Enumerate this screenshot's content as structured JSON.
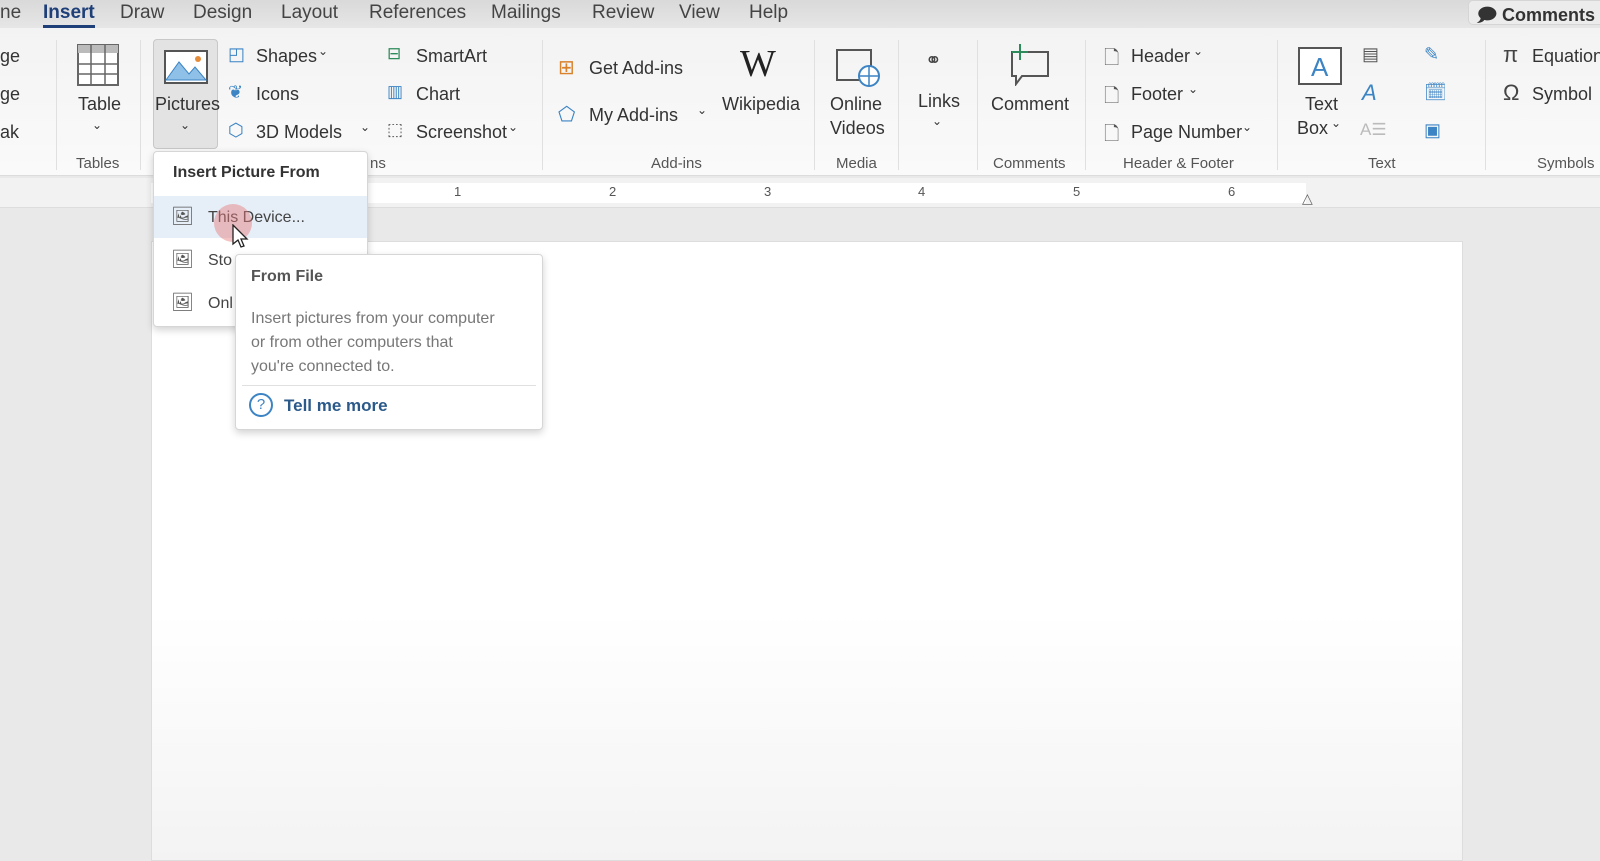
{
  "tabs": [
    {
      "label": "ne"
    },
    {
      "label": "Insert",
      "active": true
    },
    {
      "label": "Draw"
    },
    {
      "label": "Design"
    },
    {
      "label": "Layout"
    },
    {
      "label": "References"
    },
    {
      "label": "Mailings"
    },
    {
      "label": "Review"
    },
    {
      "label": "View"
    },
    {
      "label": "Help"
    }
  ],
  "comments_button": "Comments",
  "ribbon": {
    "partial_left": [
      "ge",
      "ge",
      "ak"
    ],
    "tables": {
      "table": "Table",
      "label": "Tables"
    },
    "illustrations": {
      "pictures": "Pictures",
      "shapes": "Shapes",
      "icons": "Icons",
      "models": "3D Models",
      "smartart": "SmartArt",
      "chart": "Chart",
      "screenshot": "Screenshot",
      "label_partial": "ns"
    },
    "addins": {
      "get": "Get Add-ins",
      "my": "My Add-ins",
      "wikipedia": "Wikipedia",
      "label": "Add-ins"
    },
    "media": {
      "online_videos_1": "Online",
      "online_videos_2": "Videos",
      "label": "Media"
    },
    "links": {
      "links": "Links"
    },
    "comments": {
      "comment": "Comment",
      "label": "Comments"
    },
    "header_footer": {
      "header": "Header",
      "footer": "Footer",
      "page_number": "Page Number",
      "label": "Header & Footer"
    },
    "text": {
      "text_box_1": "Text",
      "text_box_2": "Box",
      "label": "Text"
    },
    "symbols": {
      "equation": "Equation",
      "symbol": "Symbol",
      "label": "Symbols"
    }
  },
  "ruler": [
    "1",
    "2",
    "3",
    "4",
    "5",
    "6"
  ],
  "menu": {
    "title": "Insert Picture From",
    "items": [
      "This Device...",
      "Sto",
      "Onl"
    ]
  },
  "tooltip": {
    "title": "From File",
    "lines": [
      "Insert pictures from your computer",
      "or from other computers that",
      "you're connected to."
    ],
    "link": "Tell me more"
  },
  "colors": {
    "accent": "#1e3f78",
    "icon_blue": "#3c84c4",
    "menu_hover": "#e6eef8"
  }
}
